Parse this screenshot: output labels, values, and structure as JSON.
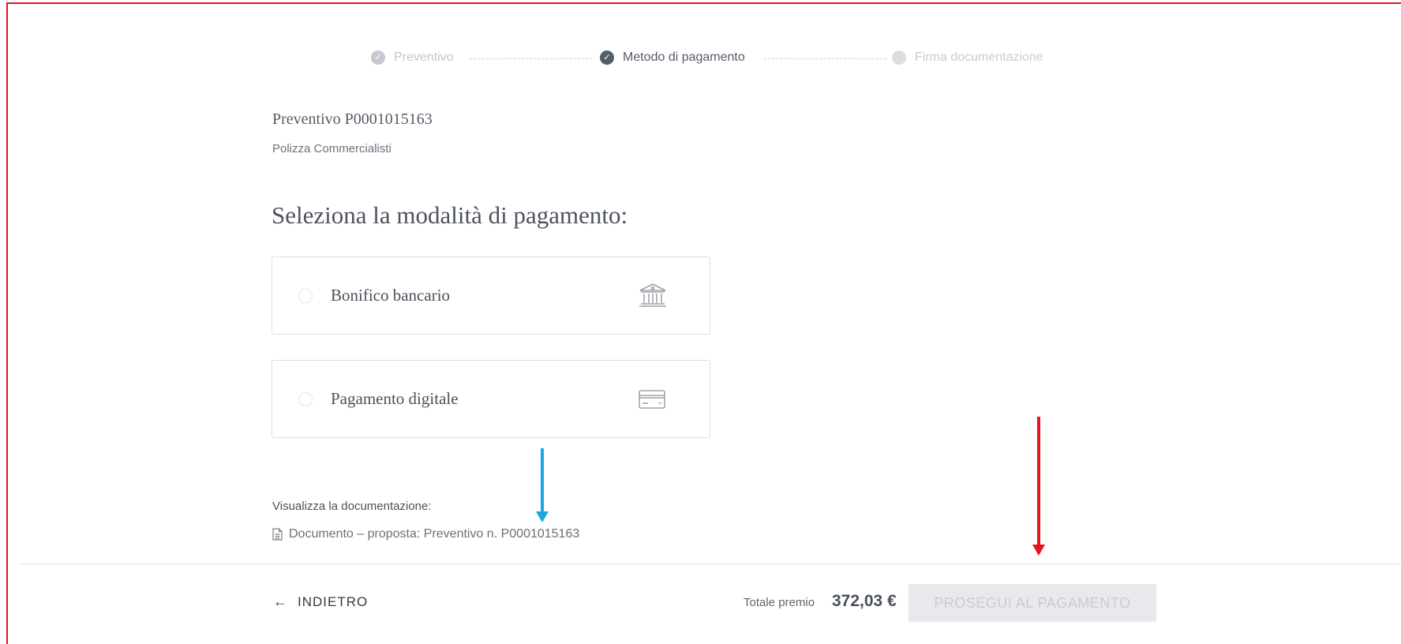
{
  "stepper": {
    "steps": [
      {
        "label": "Preventivo",
        "state": "completed"
      },
      {
        "label": "Metodo di pagamento",
        "state": "active"
      },
      {
        "label": "Firma documentazione",
        "state": "pending"
      }
    ]
  },
  "quote": {
    "title": "Preventivo P0001015163",
    "subtitle": "Polizza Commercialisti"
  },
  "payment": {
    "heading": "Seleziona la modalità di pagamento:",
    "options": [
      {
        "label": "Bonifico bancario",
        "icon": "bank-icon",
        "selected": false
      },
      {
        "label": "Pagamento digitale",
        "icon": "credit-card-icon",
        "selected": false
      }
    ]
  },
  "documents": {
    "label": "Visualizza la documentazione:",
    "link": "Documento – proposta: Preventivo n. P0001015163",
    "icon": "document-icon"
  },
  "footer": {
    "back_label": "INDIETRO",
    "total_label": "Totale premio",
    "total_value": "372,03 €",
    "proceed_label": "PROSEGUI AL PAGAMENTO"
  },
  "colors": {
    "frame": "#e8121c",
    "annotation_blue": "#1aa7e0",
    "annotation_red": "#e8121c"
  }
}
